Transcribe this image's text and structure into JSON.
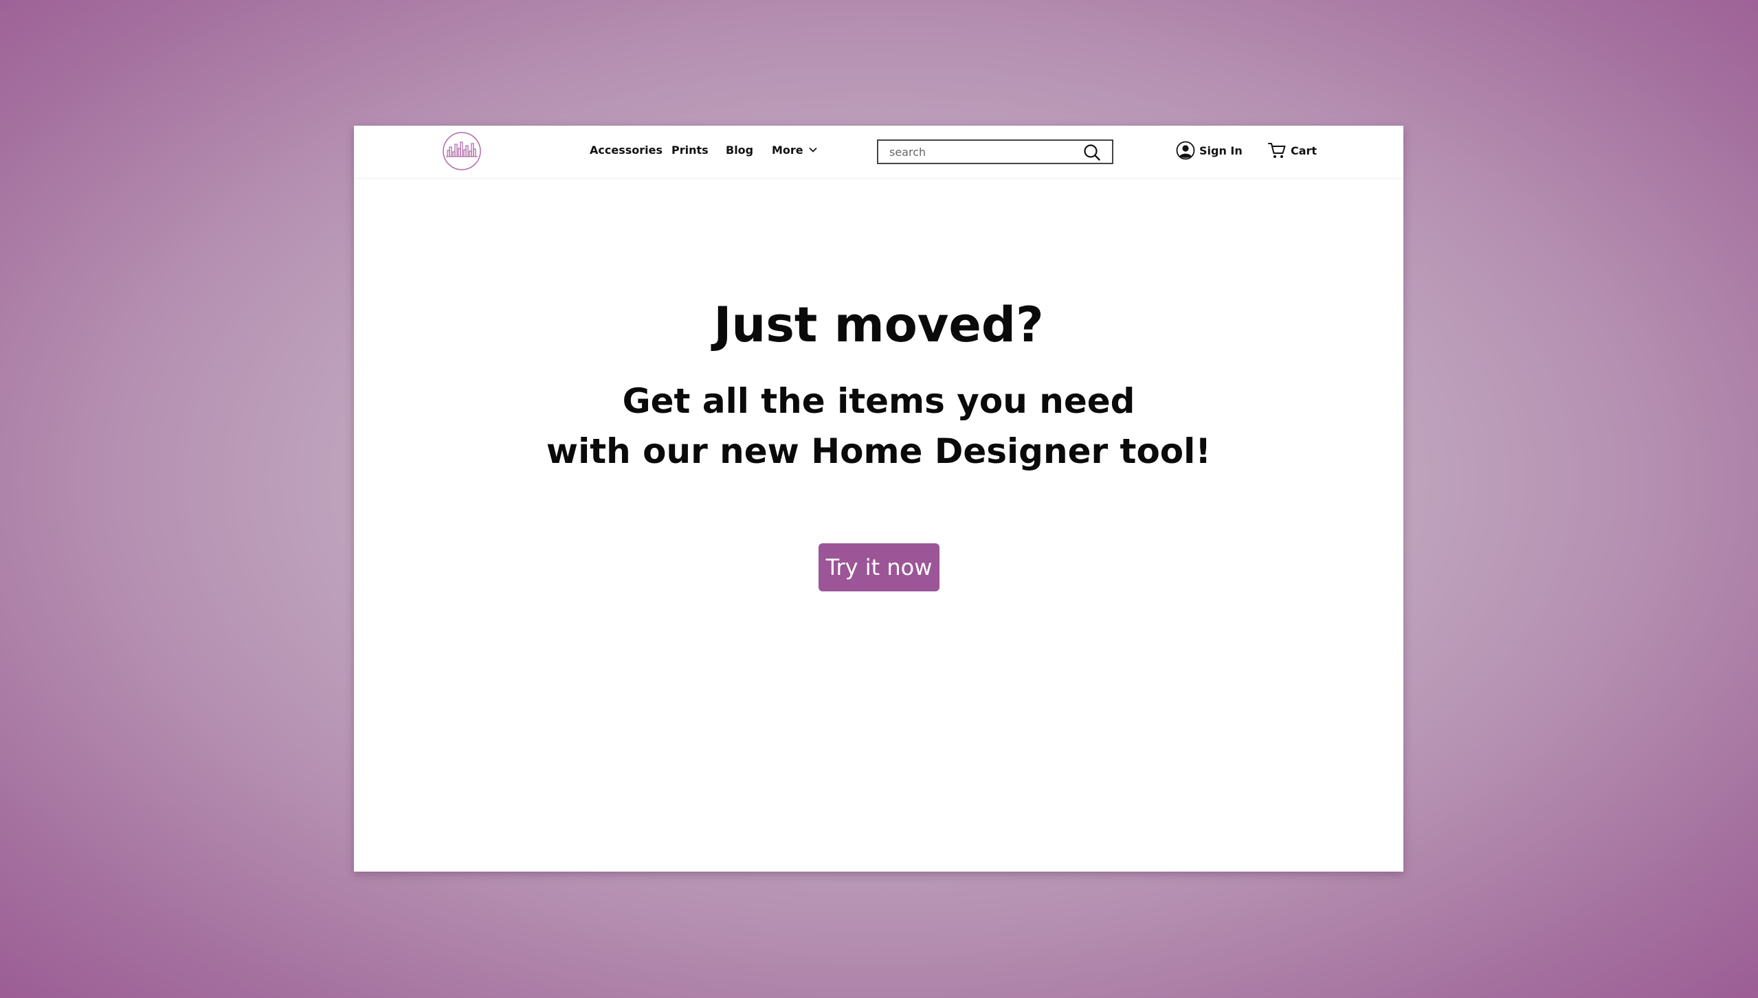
{
  "brand": {
    "accent": "#9c5596",
    "logo_color": "#b06aa8"
  },
  "nav": {
    "items": [
      {
        "label": "Accessories"
      },
      {
        "label": "Prints"
      },
      {
        "label": "Blog"
      },
      {
        "label": "More"
      }
    ]
  },
  "search": {
    "placeholder": "search",
    "value": ""
  },
  "account": {
    "signin_label": "Sign In",
    "cart_label": "Cart"
  },
  "hero": {
    "title": "Just moved?",
    "subtitle_line1": "Get all the items you need",
    "subtitle_line2": "with our new Home Designer tool!",
    "cta_label": "Try it now"
  },
  "icons": {
    "logo": "city-skyline-logo",
    "more": "chevron-down-icon",
    "search": "search-icon",
    "signin": "user-circle-icon",
    "cart": "cart-icon"
  }
}
